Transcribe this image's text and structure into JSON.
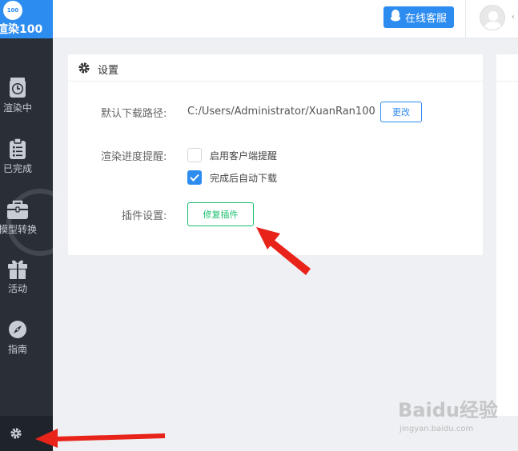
{
  "app": {
    "logo_badge": "100",
    "logo_text": "渲染100"
  },
  "sidebar": {
    "items": [
      {
        "label": "渲染中",
        "icon": "timer-icon"
      },
      {
        "label": "已完成",
        "icon": "clipboard-icon"
      },
      {
        "label": "模型转换",
        "icon": "toolbox-icon"
      },
      {
        "label": "活动",
        "icon": "gift-icon"
      },
      {
        "label": "指南",
        "icon": "compass-icon"
      }
    ],
    "footer_icon": "gear-icon"
  },
  "topbar": {
    "service_label": "在线客服",
    "user_suffix": "‹"
  },
  "settings": {
    "title": "设置",
    "download_path_label": "默认下载路径:",
    "download_path_value": "C:/Users/Administrator/XuanRan100",
    "change_button": "更改",
    "progress_label": "渲染进度提醒:",
    "option_client_reminder": "启用客户端提醒",
    "option_client_reminder_checked": false,
    "option_auto_download": "完成后自动下载",
    "option_auto_download_checked": true,
    "plugin_label": "插件设置:",
    "repair_button": "修复插件"
  },
  "watermark": {
    "brand": "Baidu经验",
    "url": "jingyan.baidu.com"
  },
  "colors": {
    "primary": "#2d8cf0",
    "success": "#19be6b",
    "sidebar_bg": "#2a2f36",
    "annotation": "#e8231a"
  }
}
